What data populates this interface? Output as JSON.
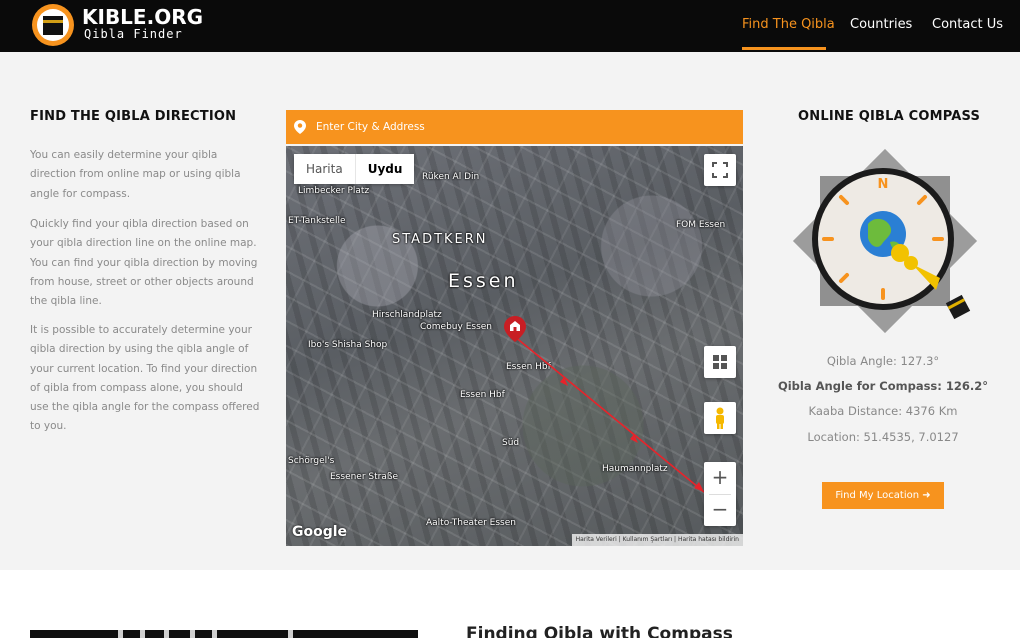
{
  "brand": {
    "name": "KIBLE.ORG",
    "tagline": "Qibla Finder",
    "accent_color": "#f7931e"
  },
  "nav": [
    {
      "label": "Find The Qibla",
      "active": true
    },
    {
      "label": "Countries"
    },
    {
      "label": "Contact Us"
    }
  ],
  "left": {
    "title": "FIND THE QIBLA DIRECTION",
    "paragraphs": [
      "You can easily determine your qibla direction from online map or using qibla angle for compass.",
      "Quickly find your qibla direction based on your qibla direction line on the online map. You can find your qibla direction by moving from house, street or other objects around the qibla line.",
      "It is possible to accurately determine your qibla direction by using the qibla angle of your current location. To find your direction of qibla from compass alone, you should use the qibla angle for the compass offered to you."
    ]
  },
  "search": {
    "placeholder": "Enter City & Address",
    "value": "",
    "icon": "map-pin-icon"
  },
  "map": {
    "type_buttons": [
      "Harita",
      "Uydu"
    ],
    "selected_type": "Uydu",
    "labels": [
      "Limbecker Platz",
      "Rüken Al Din",
      "ET-Tankstelle",
      "STADTKERN",
      "Essen",
      "FOM Essen",
      "Hirschlandplatz",
      "Comebuy Essen",
      "Ibo's Shisha Shop",
      "Essen Hbf",
      "Essen Hbf",
      "Aalto-Theater Essen",
      "Schörgel's",
      "Essener Straße",
      "Haumannplatz",
      "Süd"
    ],
    "logo": "Google",
    "attribution": "Harita Verileri  |  Kullanım Şartları  |  Harita hatası bildirin",
    "zoom_in": "+",
    "zoom_out": "−"
  },
  "compass": {
    "title": "ONLINE QIBLA COMPASS",
    "north_label": "N",
    "qibla_angle_label": "Qibla Angle: 127.3°",
    "compass_angle_label": "Qibla Angle for Compass: 126.2°",
    "kaaba_distance_label": "Kaaba Distance: 4376 Km",
    "location_label": "Location: 51.4535, 7.0127",
    "qibla_angle_value": 127.3
  },
  "find_button": {
    "label": "Find My Location ➜"
  },
  "bottom": {
    "heading": "Finding Qibla with Compass"
  }
}
